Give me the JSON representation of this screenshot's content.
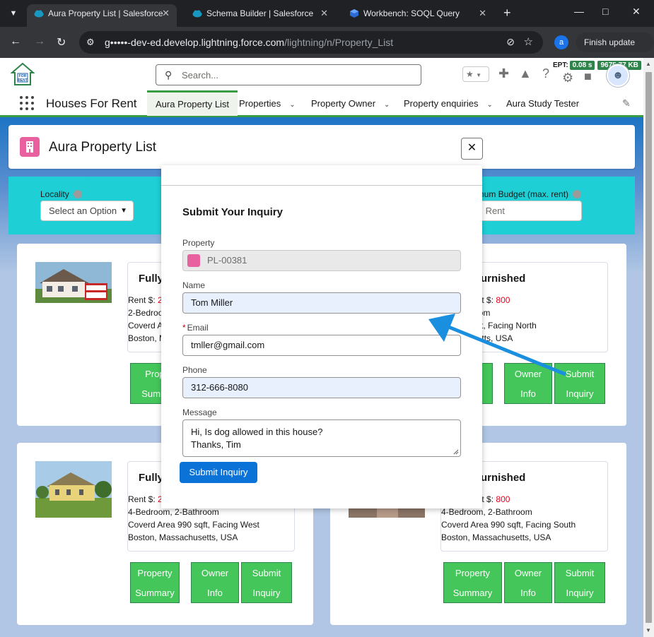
{
  "browser": {
    "tabs": [
      {
        "title": "Aura Property List | Salesforce",
        "active": true
      },
      {
        "title": "Schema Builder | Salesforce",
        "active": false
      },
      {
        "title": "Workbench: SOQL Query",
        "active": false
      }
    ],
    "url_host": "g•••••-dev-ed.develop.lightning.force.com",
    "url_path": "/lightning/n/Property_List",
    "profile_initial": "a",
    "finish_update": "Finish update"
  },
  "sf_header": {
    "search_placeholder": "Search...",
    "ept_label": "EPT:",
    "ept_value": "0.08 s",
    "ept_size": "9675.77 KB",
    "logo_text": "FOR RENT"
  },
  "nav": {
    "app_name": "Houses For Rent",
    "items": [
      {
        "label": "Aura Property List",
        "active": true
      },
      {
        "label": "Properties",
        "dropdown": true
      },
      {
        "label": "Property Owner",
        "dropdown": true
      },
      {
        "label": "Property enquiries",
        "dropdown": true
      },
      {
        "label": "Aura Study Tester",
        "dropdown": false
      }
    ]
  },
  "page": {
    "title": "Aura Property List",
    "filters": {
      "locality_label": "Locality",
      "locality_value": "Select an Option",
      "budget_label_partial": "imum Budget (max. rent)",
      "budget_placeholder_partial": "ter Max. Rent"
    },
    "cards": [
      {
        "title": "Fully",
        "lines": [
          "Rent $: 2",
          "2-Bedroo",
          "Coverd A",
          "Boston, M"
        ],
        "buttons": [
          "Prop",
          "Summ"
        ]
      },
      {
        "title": "urnished",
        "deposit_label": "Deposit $:",
        "rent_partial": "00",
        "deposit_value": "800",
        "lines": [
          ", 2-Bathroom",
          "ea 990 sqft, Facing North",
          "assachusetts, USA"
        ],
        "buttons": [
          "erty",
          "ary",
          "Owner",
          "Info",
          "Submit",
          "Inquiry"
        ]
      },
      {
        "title": "Fully",
        "lines": [
          "Rent $: 2",
          "4-Bedroom, 2-Bathroom",
          "Coverd Area 990 sqft, Facing West",
          "Boston, Massachusetts, USA"
        ],
        "buttons": [
          "Property",
          "Summary",
          "Owner",
          "Info",
          "Submit",
          "Inquiry"
        ]
      },
      {
        "title": "urnished",
        "deposit_label": "Deposit $:",
        "rent_partial": "00",
        "deposit_value": "800",
        "lines": [
          "4-Bedroom, 2-Bathroom",
          "Coverd Area 990 sqft, Facing South",
          "Boston, Massachusetts, USA"
        ],
        "buttons": [
          "Property",
          "Summary",
          "Owner",
          "Info",
          "Submit",
          "Inquiry"
        ]
      }
    ]
  },
  "modal": {
    "title": "Submit Your Inquiry",
    "property_label": "Property",
    "property_value": "PL-00381",
    "name_label": "Name",
    "name_value": "Tom Miller",
    "email_label": "Email",
    "email_required": "*",
    "email_value": "tmller@gmail.com",
    "phone_label": "Phone",
    "phone_value": "312-666-8080",
    "message_label": "Message",
    "message_line1": "Hi, Is dog allowed in this house?",
    "message_line2": "Thanks, Tim",
    "submit_label": "Submit Inquiry",
    "close_symbol": "✕"
  },
  "colors": {
    "chrome_dark": "#202124",
    "chrome_tab": "#35363a",
    "sf_green": "#3a9b47",
    "button_green": "#45c65a",
    "filter_cyan": "#1ed0d6",
    "brand_blue": "#0b72d8",
    "arrow_blue": "#1a8fe0",
    "accent_pink": "#e8609d"
  }
}
